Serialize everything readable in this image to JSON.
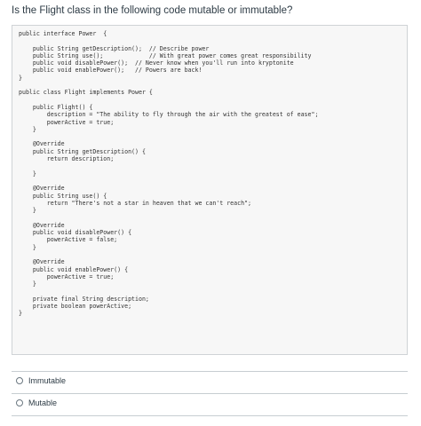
{
  "question": {
    "text": "Is the Flight class in the following code mutable or immutable?"
  },
  "code": {
    "lines": [
      "public interface Power  {",
      "",
      "    public String getDescription();  // Describe power",
      "    public String use();             // With great power comes great responsibility",
      "    public void disablePower();  // Never know when you'll run into kryptonite",
      "    public void enablePower();   // Powers are back!",
      "}",
      "",
      "public class Flight implements Power {",
      "",
      "    public Flight() {",
      "        description = \"The ability to fly through the air with the greatest of ease\";",
      "        powerActive = true;",
      "    }",
      "",
      "    @Override",
      "    public String getDescription() {",
      "        return description;",
      "",
      "    }",
      "",
      "    @Override",
      "    public String use() {",
      "        return \"There's not a star in heaven that we can't reach\";",
      "    }",
      "",
      "    @Override",
      "    public void disablePower() {",
      "        powerActive = false;",
      "    }",
      "",
      "    @Override",
      "    public void enablePower() {",
      "        powerActive = true;",
      "    }",
      "",
      "    private final String description;",
      "    private boolean powerActive;",
      "}"
    ]
  },
  "options": [
    {
      "label": "Immutable",
      "selected": false
    },
    {
      "label": "Mutable",
      "selected": false
    }
  ]
}
